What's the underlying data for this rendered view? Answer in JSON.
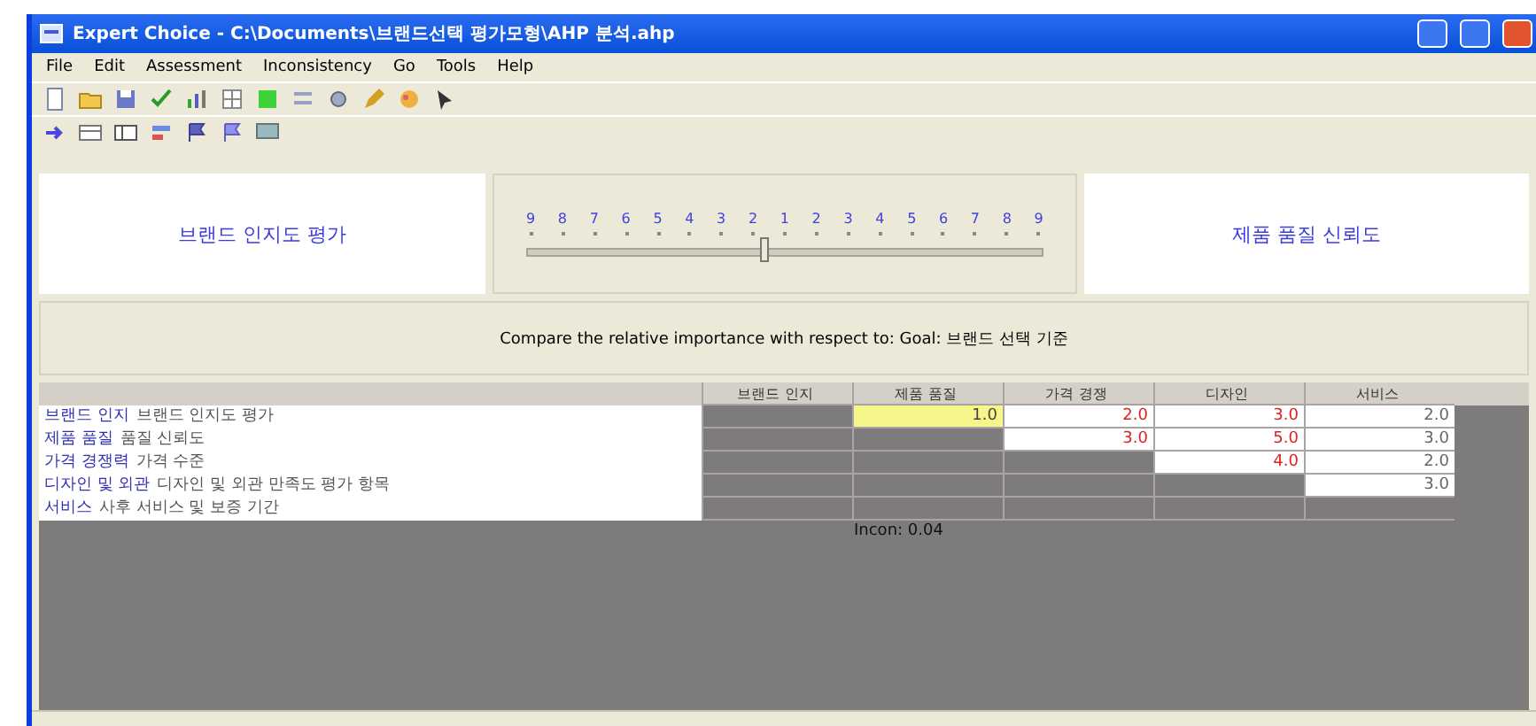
{
  "window": {
    "title": "Expert Choice - C:\\Documents\\브랜드선택 평가모형\\AHP 분석.ahp"
  },
  "menu": [
    "File",
    "Edit",
    "Assessment",
    "Inconsistency",
    "Go",
    "Tools",
    "Help"
  ],
  "comparison": {
    "left": "브랜드 인지도 평가",
    "right": "제품 품질 신뢰도",
    "scale": [
      "9",
      "8",
      "7",
      "6",
      "5",
      "4",
      "3",
      "2",
      "1",
      "2",
      "3",
      "4",
      "5",
      "6",
      "7",
      "8",
      "9"
    ],
    "level": 0.46
  },
  "prompt": "Compare the relative importance with respect to: Goal: 브랜드 선택 기준",
  "matrix": {
    "columns": [
      "브랜드 인지",
      "제품 품질",
      "가격 경쟁",
      "디자인",
      "서비스"
    ],
    "rows": [
      {
        "label": "브랜드 인지",
        "description": "브랜드 인지도 평가",
        "cells": [
          {
            "kind": "blank"
          },
          {
            "kind": "value",
            "value": "1.0",
            "inverse": false,
            "selected": true
          },
          {
            "kind": "value",
            "value": "2.0",
            "inverse": true,
            "selected": false
          },
          {
            "kind": "value",
            "value": "3.0",
            "inverse": true,
            "selected": false
          },
          {
            "kind": "value",
            "value": "2.0",
            "inverse": false,
            "selected": false
          }
        ]
      },
      {
        "label": "제품 품질",
        "description": "품질 신뢰도",
        "cells": [
          {
            "kind": "blank"
          },
          {
            "kind": "blank"
          },
          {
            "kind": "value",
            "value": "3.0",
            "inverse": true,
            "selected": false
          },
          {
            "kind": "value",
            "value": "5.0",
            "inverse": true,
            "selected": false
          },
          {
            "kind": "value",
            "value": "3.0",
            "inverse": false,
            "selected": false
          }
        ]
      },
      {
        "label": "가격 경쟁력",
        "description": "가격 수준",
        "cells": [
          {
            "kind": "blank"
          },
          {
            "kind": "blank"
          },
          {
            "kind": "blank"
          },
          {
            "kind": "value",
            "value": "4.0",
            "inverse": true,
            "selected": false
          },
          {
            "kind": "value",
            "value": "2.0",
            "inverse": false,
            "selected": false
          }
        ]
      },
      {
        "label": "디자인 및 외관",
        "description": "디자인 및 외관 만족도 평가 항목",
        "cells": [
          {
            "kind": "blank"
          },
          {
            "kind": "blank"
          },
          {
            "kind": "blank"
          },
          {
            "kind": "blank"
          },
          {
            "kind": "value",
            "value": "3.0",
            "inverse": false,
            "selected": false
          }
        ]
      },
      {
        "label": "서비스",
        "description": "사후 서비스 및 보증 기간",
        "cells": [
          {
            "kind": "blank"
          },
          {
            "kind": "blank"
          },
          {
            "kind": "blank"
          },
          {
            "kind": "blank"
          },
          {
            "kind": "blank"
          }
        ]
      }
    ],
    "inconsistency": "Incon: 0.04"
  }
}
